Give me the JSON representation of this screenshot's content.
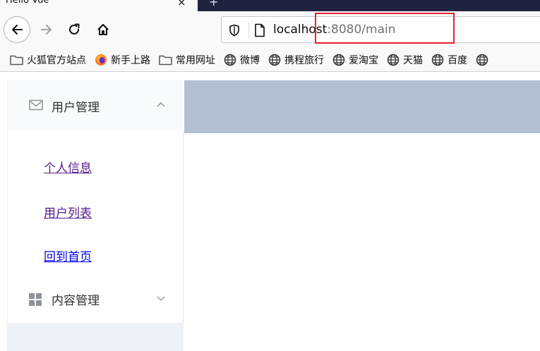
{
  "browser": {
    "tab_title": "Hello Vue",
    "tab_close": "×",
    "new_tab": "+",
    "url_host": "localhost",
    "url_path": ":8080/main"
  },
  "bookmarks": [
    {
      "label": "火狐官方站点",
      "icon": "folder-icon"
    },
    {
      "label": "新手上路",
      "icon": "firefox-icon"
    },
    {
      "label": "常用网址",
      "icon": "folder-icon"
    },
    {
      "label": "微博",
      "icon": "globe-icon"
    },
    {
      "label": "携程旅行",
      "icon": "globe-icon"
    },
    {
      "label": "爱淘宝",
      "icon": "globe-icon"
    },
    {
      "label": "天猫",
      "icon": "globe-icon"
    },
    {
      "label": "百度",
      "icon": "globe-icon"
    }
  ],
  "sidebar": {
    "user_menu": {
      "label": "用户管理",
      "icon": "mail-icon",
      "expanded": true
    },
    "user_items": [
      {
        "label": "个人信息"
      },
      {
        "label": "用户列表"
      },
      {
        "label": "回到首页"
      }
    ],
    "content_menu": {
      "label": "内容管理",
      "icon": "grid-icon",
      "expanded": false
    }
  },
  "colors": {
    "header": "#b3c0d1",
    "highlight": "#e8222c",
    "visited_link": "#551a8b",
    "link": "#0000ee"
  }
}
